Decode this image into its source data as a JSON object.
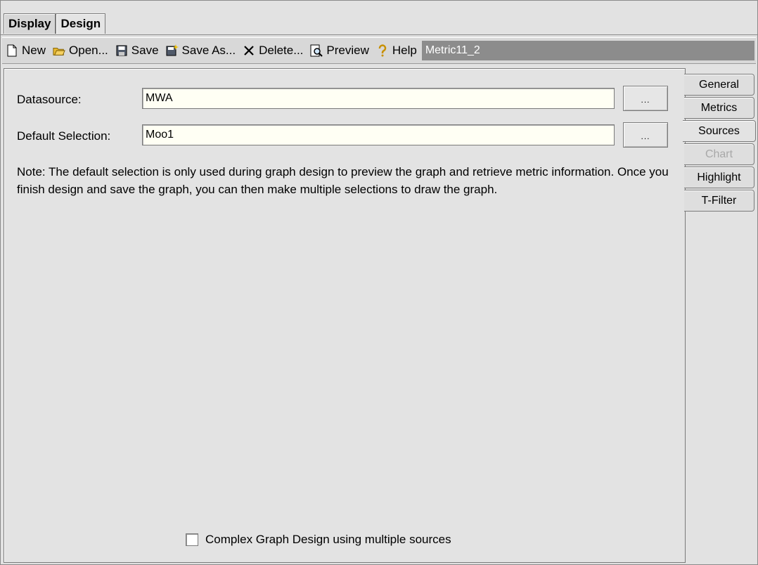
{
  "top_tabs": [
    {
      "label": "Display"
    },
    {
      "label": "Design"
    }
  ],
  "toolbar": {
    "new_label": "New",
    "open_label": "Open...",
    "save_label": "Save",
    "save_as_label": "Save As...",
    "delete_label": "Delete...",
    "preview_label": "Preview",
    "help_label": "Help",
    "metric_name": "Metric11_2"
  },
  "form": {
    "datasource_label": "Datasource:",
    "datasource_value": "MWA",
    "default_selection_label": "Default Selection:",
    "default_selection_value": "Moo1",
    "browse_label": "...",
    "note": "Note: The default selection is only used during graph design to preview the graph and retrieve metric information.  Once you finish design and save the graph, you can then make multiple selections to draw the graph.",
    "complex_label": "Complex Graph Design using multiple sources",
    "complex_checked": false
  },
  "side_tabs": [
    {
      "label": "General",
      "state": "normal"
    },
    {
      "label": "Metrics",
      "state": "normal"
    },
    {
      "label": "Sources",
      "state": "active"
    },
    {
      "label": "Chart",
      "state": "disabled"
    },
    {
      "label": "Highlight",
      "state": "normal"
    },
    {
      "label": "T-Filter",
      "state": "normal"
    }
  ],
  "colors": {
    "metric_name_bg": "#8c8c8c",
    "field_bg": "#fffff4",
    "disabled_text": "#a8a8a8"
  }
}
